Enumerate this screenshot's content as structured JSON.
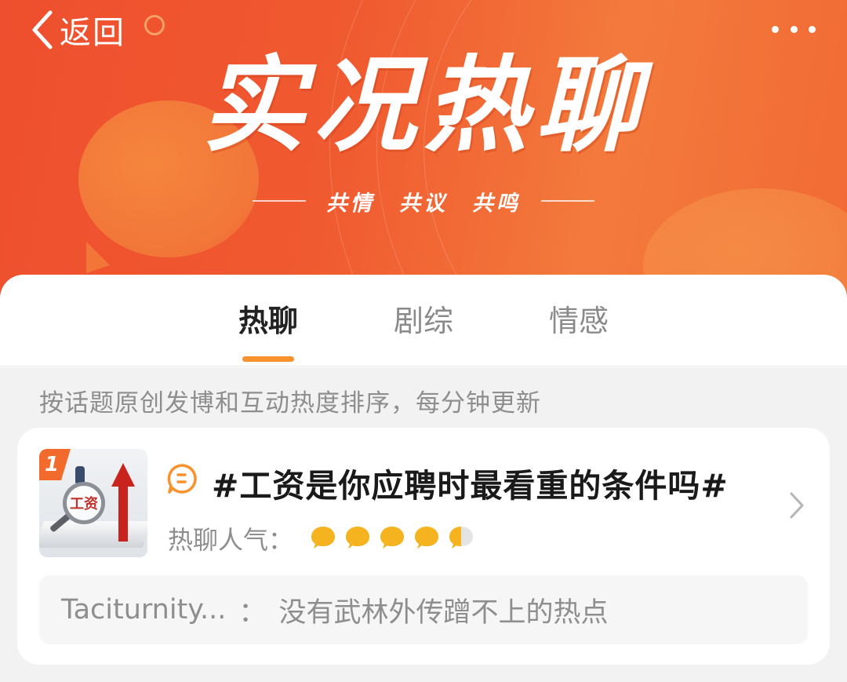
{
  "nav": {
    "back_label": "返回"
  },
  "hero": {
    "title": "实况热聊",
    "tagline": "共情　共议　共鸣"
  },
  "tabs": [
    {
      "label": "热聊",
      "active": true
    },
    {
      "label": "剧综",
      "active": false
    },
    {
      "label": "情感",
      "active": false
    }
  ],
  "notice": "按话题原创发博和互动热度排序，每分钟更新",
  "topics": [
    {
      "rank": "1",
      "thumbnail_text": "工资",
      "title": "#工资是你应聘时最看重的条件吗#",
      "heat_label": "热聊人气：",
      "heat_level": 4.5,
      "heat_max": 5,
      "comment_user": "Taciturnity...",
      "comment_sep": "：",
      "comment_text": "没有武林外传蹭不上的热点"
    }
  ],
  "colors": {
    "accent": "#f7922c",
    "banner": "#ee4f2e",
    "heat": "#f5b41f"
  }
}
